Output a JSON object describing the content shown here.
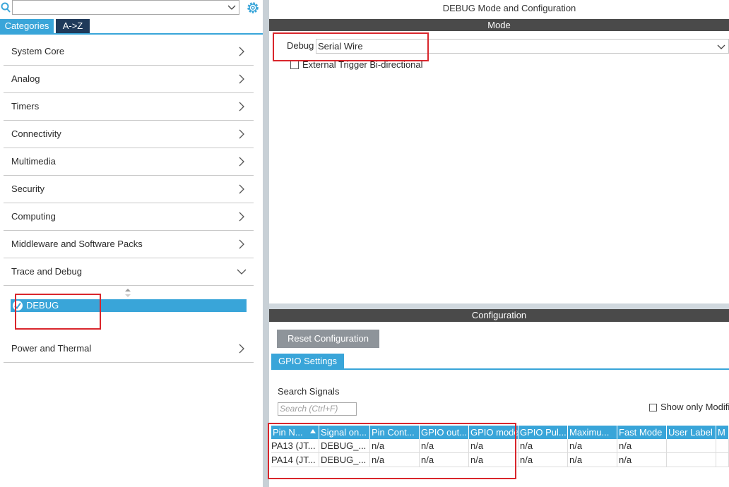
{
  "left_panel": {
    "search": {
      "value": "",
      "placeholder": ""
    },
    "tabs": [
      {
        "label": "Categories",
        "active": true
      },
      {
        "label": "A->Z",
        "active": false
      }
    ],
    "categories": [
      {
        "label": "System Core",
        "expanded": false
      },
      {
        "label": "Analog",
        "expanded": false
      },
      {
        "label": "Timers",
        "expanded": false
      },
      {
        "label": "Connectivity",
        "expanded": false
      },
      {
        "label": "Multimedia",
        "expanded": false
      },
      {
        "label": "Security",
        "expanded": false
      },
      {
        "label": "Computing",
        "expanded": false
      },
      {
        "label": "Middleware and Software Packs",
        "expanded": false
      },
      {
        "label": "Trace and Debug",
        "expanded": true
      },
      {
        "label": "Power and Thermal",
        "expanded": false
      }
    ],
    "trace_debug_children": [
      {
        "label": "DEBUG",
        "selected": true,
        "status": "enabled"
      }
    ]
  },
  "right_panel": {
    "title": "DEBUG Mode and Configuration",
    "mode_header": "Mode",
    "debug_label": "Debug",
    "debug_value": "Serial Wire",
    "external_trigger_label": "External Trigger Bi-directional",
    "external_trigger_checked": false,
    "config_header": "Configuration",
    "reset_button": "Reset Configuration",
    "gpio_tab": "GPIO Settings",
    "search_signals_label": "Search Signals",
    "search_signals_placeholder": "Search (Ctrl+F)",
    "show_only_label": "Show only Modifi",
    "show_only_checked": false,
    "table": {
      "columns": [
        "Pin N...",
        "Signal on...",
        "Pin Cont...",
        "GPIO out...",
        "GPIO mode",
        "GPIO Pul...",
        "Maximu...",
        "Fast Mode",
        "User Label",
        "M"
      ],
      "rows": [
        [
          "PA13 (JT...",
          "DEBUG_...",
          "n/a",
          "n/a",
          "n/a",
          "n/a",
          "n/a",
          "n/a",
          "",
          ""
        ],
        [
          "PA14 (JT...",
          "DEBUG_...",
          "n/a",
          "n/a",
          "n/a",
          "n/a",
          "n/a",
          "n/a",
          "",
          ""
        ]
      ]
    }
  },
  "colors": {
    "accent": "#39a5d9",
    "header_dark": "#4a4a4a",
    "annotation_red": "#d9262c"
  }
}
